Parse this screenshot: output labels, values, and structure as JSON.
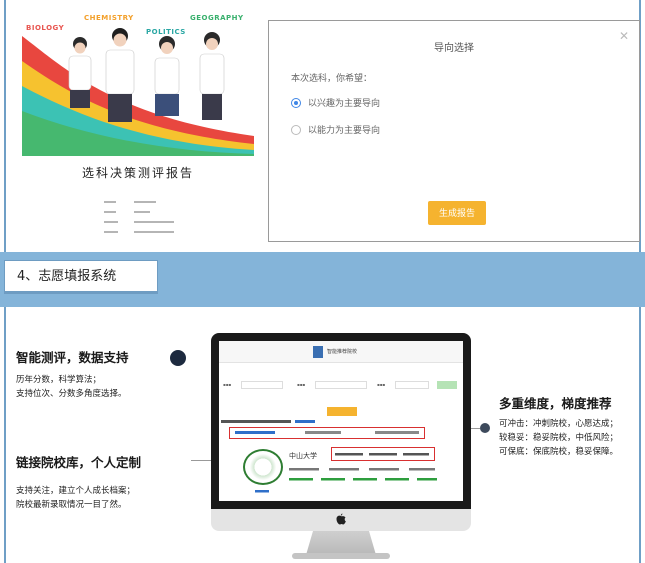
{
  "report": {
    "subjects": {
      "biology": "BIOLOGY",
      "chemistry": "CHEMISTRY",
      "politics": "POLITICS",
      "geography": "GEOGRAPHY"
    },
    "title": "选科决策测评报告"
  },
  "dialog": {
    "title": "导向选择",
    "close_icon": "close-icon",
    "question": "本次选科，你希望：",
    "options": [
      {
        "label": "以兴趣为主要导向",
        "selected": true
      },
      {
        "label": "以能力为主要导向",
        "selected": false
      }
    ],
    "generate_label": "生成报告"
  },
  "section": {
    "label": "4、志愿填报系统"
  },
  "features": {
    "f1_title": "智能测评，数据支持",
    "f1_line1": "历年分数，科学算法；",
    "f1_line2": "支持位次、分数多角度选择。",
    "f2_title": "链接院校库，个人定制",
    "f2_line1": "支持关注，建立个人成长档案；",
    "f2_line2": "院校最新录取情况一目了然。",
    "f3_title": "多重维度，梯度推荐",
    "f3_line1": "可冲击：冲刺院校，心愿达成；",
    "f3_line2": "较稳妥：稳妥院校，中低风险；",
    "f3_line3": "可保底：保底院校，稳妥保障。"
  },
  "screen": {
    "title": "智能推荐院校",
    "uni_name": "中山大学"
  },
  "colors": {
    "band": "#84b4d9",
    "accent_button": "#f5b32f",
    "radio_selected": "#3f86e6",
    "highlight_box": "#d83030"
  }
}
